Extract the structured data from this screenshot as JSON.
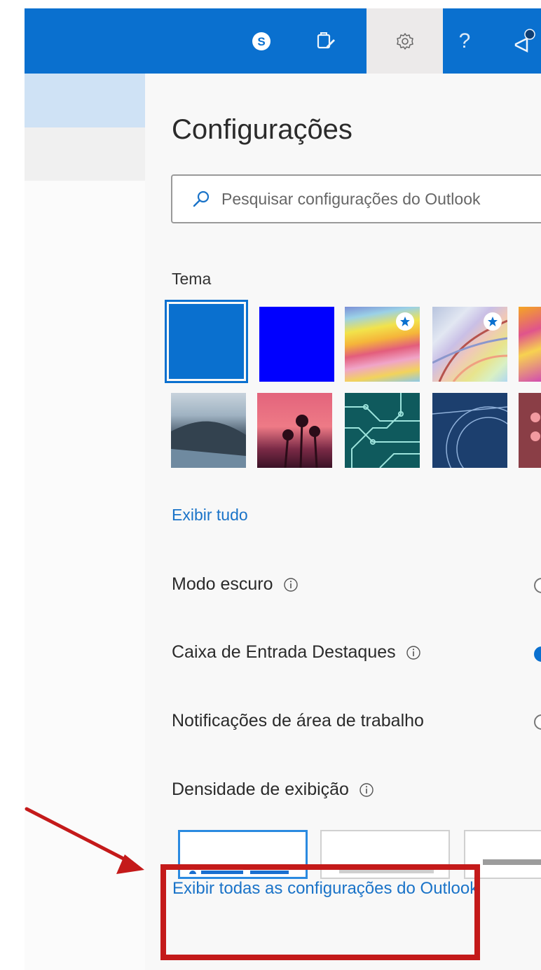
{
  "header": {
    "icons": [
      "skype-icon",
      "feedback-icon",
      "gear-icon",
      "help-icon",
      "announcement-icon"
    ],
    "help_label": "?",
    "brand_color": "#0a70cf"
  },
  "settings": {
    "title": "Configurações",
    "search": {
      "placeholder": "Pesquisar configurações do Outlook"
    },
    "theme": {
      "label": "Tema",
      "tiles": [
        {
          "name": "blue",
          "selected": true
        },
        {
          "name": "bright-blue"
        },
        {
          "name": "rainbow-stripes",
          "premium": true
        },
        {
          "name": "abstract-lines",
          "premium": true
        },
        {
          "name": "colorful-art"
        },
        {
          "name": "mountain"
        },
        {
          "name": "palm-sunset"
        },
        {
          "name": "circuit-board"
        },
        {
          "name": "blueprint"
        },
        {
          "name": "pink-lights"
        }
      ],
      "view_all": "Exibir tudo"
    },
    "options": [
      {
        "label": "Modo escuro",
        "info": true,
        "on": false
      },
      {
        "label": "Caixa de Entrada Destaques",
        "info": true,
        "on": true
      },
      {
        "label": "Notificações de área de trabalho",
        "info": false,
        "on": false
      }
    ],
    "density": {
      "label": "Densidade de exibição"
    },
    "footer_link": "Exibir todas as configurações do Outlook"
  },
  "annotation": {
    "color": "#c41a1a"
  }
}
